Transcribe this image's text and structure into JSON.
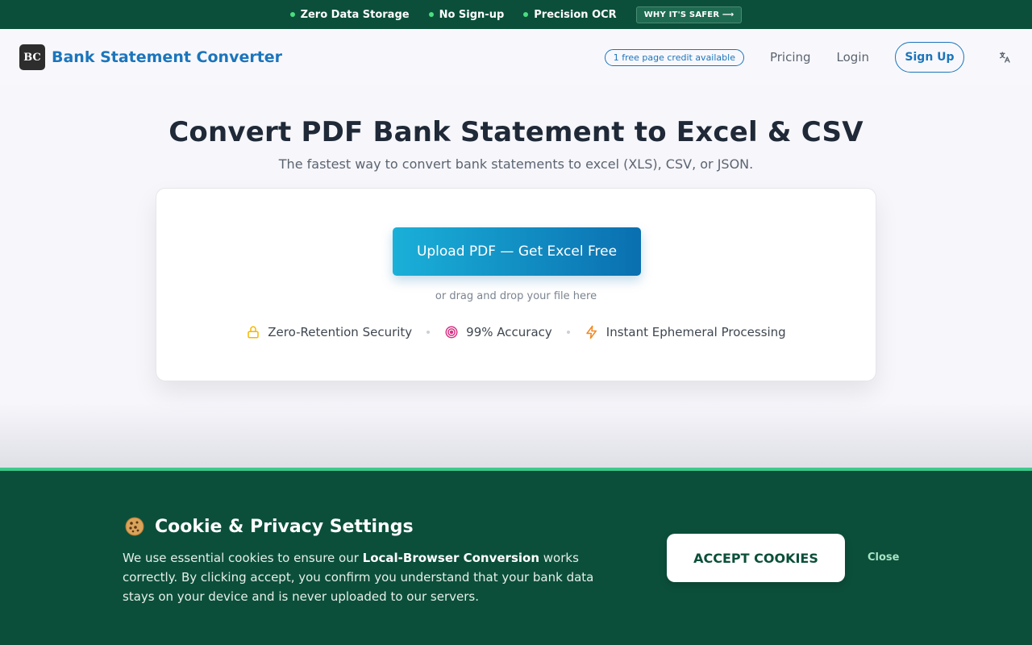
{
  "topbar": {
    "items": [
      "Zero Data Storage",
      "No Sign-up",
      "Precision OCR"
    ],
    "safer_button": "WHY IT'S SAFER ⟶"
  },
  "header": {
    "logo_mark": "BC",
    "logo_text": "Bank Statement Converter",
    "credit_pill": "1 free page credit available",
    "pricing": "Pricing",
    "login": "Login",
    "signup": "Sign Up"
  },
  "hero": {
    "title": "Convert PDF Bank Statement to Excel & CSV",
    "subtitle": "The fastest way to convert bank statements to excel (XLS), CSV, or JSON."
  },
  "upload": {
    "button": "Upload PDF — Get Excel Free",
    "drag_text": "or drag and drop your file here",
    "features": [
      {
        "label": "Zero-Retention Security",
        "icon": "lock-icon",
        "color": "#f5b800"
      },
      {
        "label": "99% Accuracy",
        "icon": "target-icon",
        "color": "#d63384"
      },
      {
        "label": "Instant Ephemeral Processing",
        "icon": "lightning-icon",
        "color": "#f08a24"
      }
    ]
  },
  "cookie": {
    "title": "Cookie & Privacy Settings",
    "text_before": "We use essential cookies to ensure our ",
    "text_bold": "Local-Browser Conversion",
    "text_after": " works correctly. By clicking accept, you confirm you understand that your bank data stays on your device and is never uploaded to our servers.",
    "accept": "ACCEPT COOKIES",
    "close": "Close"
  },
  "colors": {
    "brand_green": "#0b4f3a",
    "brand_blue": "#1b75bc",
    "accent_green": "#3fc98c"
  }
}
